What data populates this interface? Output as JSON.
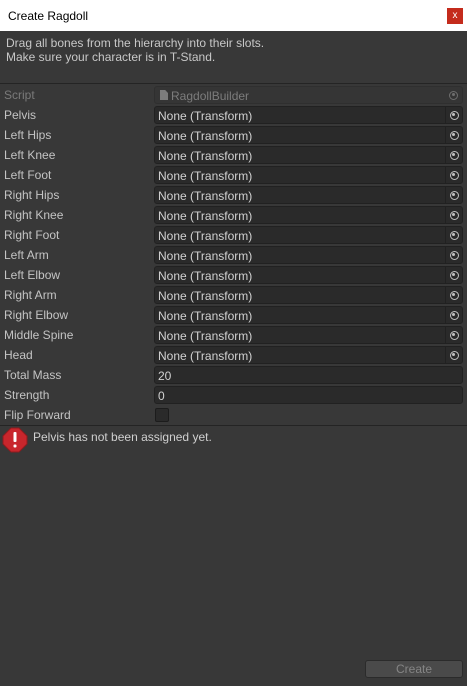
{
  "window": {
    "title": "Create Ragdoll",
    "close_glyph": "x"
  },
  "help": {
    "line1": "Drag all bones from the hierarchy into their slots.",
    "line2": "Make sure your character is in T-Stand."
  },
  "script_field": {
    "label": "Script",
    "value": "RagdollBuilder",
    "icon": "file-icon"
  },
  "bones": [
    {
      "label": "Pelvis",
      "value": "None (Transform)"
    },
    {
      "label": "Left Hips",
      "value": "None (Transform)"
    },
    {
      "label": "Left Knee",
      "value": "None (Transform)"
    },
    {
      "label": "Left Foot",
      "value": "None (Transform)"
    },
    {
      "label": "Right Hips",
      "value": "None (Transform)"
    },
    {
      "label": "Right Knee",
      "value": "None (Transform)"
    },
    {
      "label": "Right Foot",
      "value": "None (Transform)"
    },
    {
      "label": "Left Arm",
      "value": "None (Transform)"
    },
    {
      "label": "Left Elbow",
      "value": "None (Transform)"
    },
    {
      "label": "Right Arm",
      "value": "None (Transform)"
    },
    {
      "label": "Right Elbow",
      "value": "None (Transform)"
    },
    {
      "label": "Middle Spine",
      "value": "None (Transform)"
    },
    {
      "label": "Head",
      "value": "None (Transform)"
    }
  ],
  "total_mass": {
    "label": "Total Mass",
    "value": "20"
  },
  "strength": {
    "label": "Strength",
    "value": "0"
  },
  "flip_forward": {
    "label": "Flip Forward",
    "checked": false
  },
  "error": {
    "icon": "error-icon",
    "message": "Pelvis has not been assigned yet.",
    "color": "#c8262c"
  },
  "create_button": {
    "label": "Create",
    "enabled": false
  },
  "colors": {
    "background": "#383838",
    "field": "#2a2a2a",
    "close": "#c42b1c"
  }
}
